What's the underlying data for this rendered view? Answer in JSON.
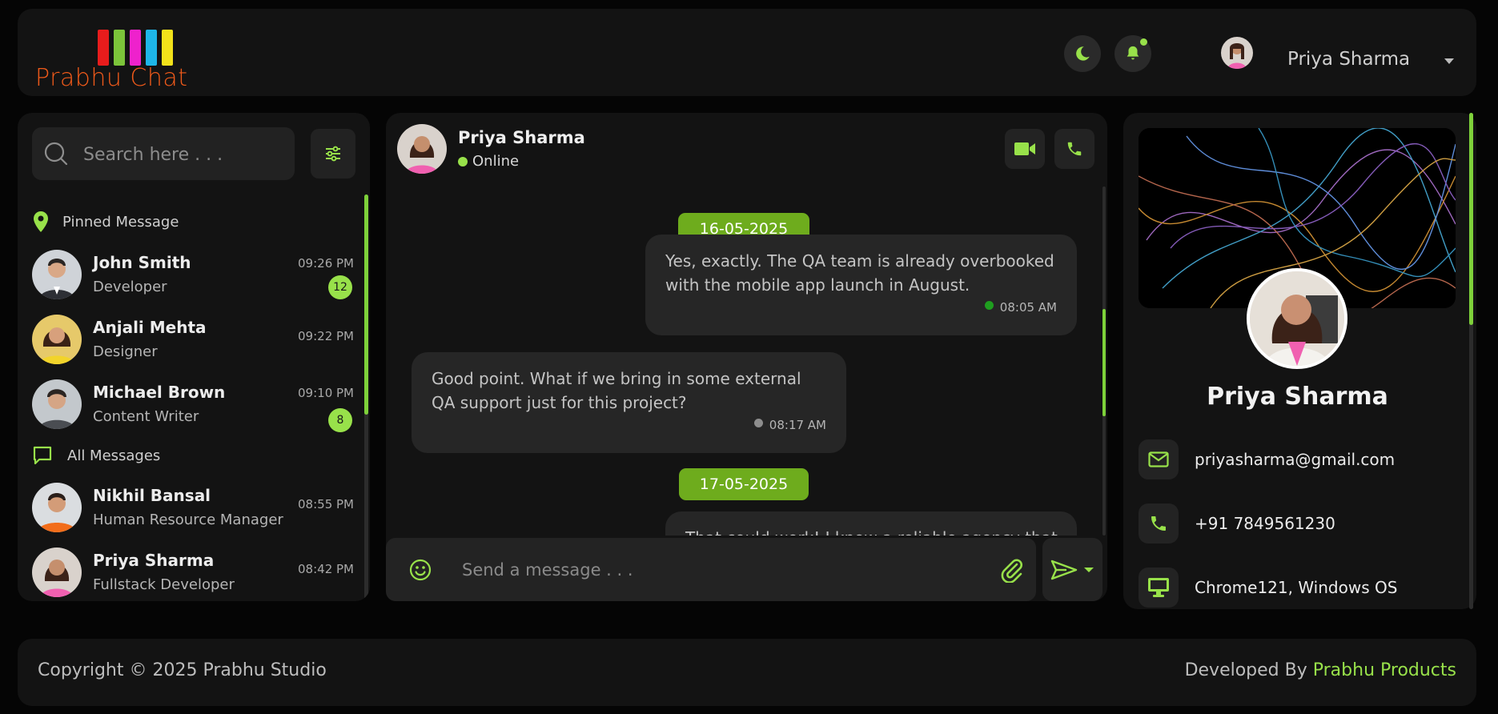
{
  "app": {
    "logo_text": "Prabhu Chat",
    "logo_bar_colors": [
      "#e81c1c",
      "#7cc43a",
      "#ee22cc",
      "#1eb6e8",
      "#f2e21a"
    ],
    "accent": "#98e14a"
  },
  "header": {
    "user_name": "Priya Sharma",
    "icons": [
      "moon-icon",
      "bell-icon"
    ]
  },
  "sidebar": {
    "search_placeholder": "Search here . . .",
    "pinned_title": "Pinned Message",
    "all_title": "All Messages",
    "pinned": [
      {
        "name": "John Smith",
        "role": "Developer",
        "time": "09:26 PM",
        "badge": "12"
      },
      {
        "name": "Anjali Mehta",
        "role": "Designer",
        "time": "09:22 PM",
        "badge": ""
      },
      {
        "name": "Michael Brown",
        "role": "Content Writer",
        "time": "09:10 PM",
        "badge": "8"
      }
    ],
    "all": [
      {
        "name": "Nikhil Bansal",
        "role": "Human Resource Manager",
        "time": "08:55 PM"
      },
      {
        "name": "Priya Sharma",
        "role": "Fullstack Developer",
        "time": "08:42 PM"
      }
    ]
  },
  "chat": {
    "contact_name": "Priya Sharma",
    "status": "Online",
    "dates": [
      "16-05-2025",
      "17-05-2025"
    ],
    "messages": [
      {
        "text": "Yes, exactly. The QA team is already overbooked with the mobile app launch in August.",
        "time": "08:05 AM",
        "direction": "outgoing",
        "status_color": "#1f9e1f"
      },
      {
        "text": "Good point. What if we bring in some external QA support just for this project?",
        "time": "08:17 AM",
        "direction": "incoming",
        "status_color": "#8d8d8d"
      },
      {
        "text": "That could work! I know a reliable agency that",
        "time": "",
        "direction": "outgoing",
        "status_color": ""
      }
    ],
    "composer_placeholder": "Send a message . . ."
  },
  "profile": {
    "name": "Priya Sharma",
    "email": "priyasharma@gmail.com",
    "phone": "+91 7849561230",
    "device": "Chrome121, Windows OS"
  },
  "footer": {
    "copyright": "Copyright © 2025 Prabhu Studio",
    "developed_prefix": "Developed By ",
    "developed_link": "Prabhu Products"
  }
}
